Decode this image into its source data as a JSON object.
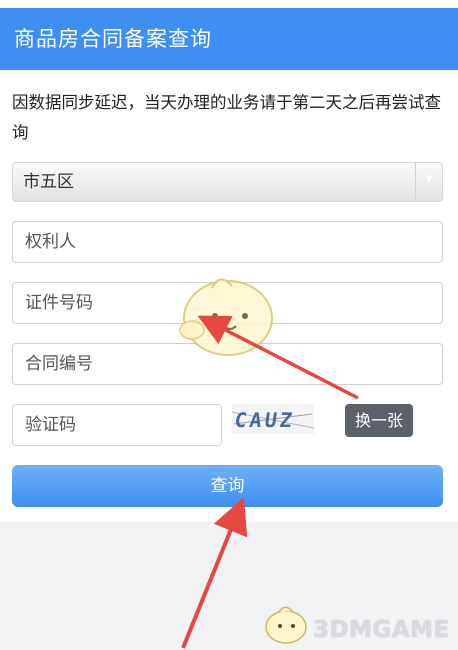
{
  "header": {
    "title": "商品房合同备案查询"
  },
  "notice": {
    "text": "因数据同步延迟，当天办理的业务请于第二天之后再尝试查询"
  },
  "district_select": {
    "value": "市五区"
  },
  "fields": {
    "owner": {
      "placeholder": "权利人"
    },
    "id_number": {
      "placeholder": "证件号码"
    },
    "contract_number": {
      "placeholder": "合同编号"
    },
    "captcha": {
      "placeholder": "验证码"
    }
  },
  "captcha_image": {
    "text": "CAUZ"
  },
  "buttons": {
    "swap_label": "换一张",
    "submit_label": "查询"
  },
  "watermark": {
    "text": "3DMGAME"
  },
  "colors": {
    "header": "#3f8ef2",
    "submit": "#3e8ef0",
    "arrow": "#e5483f",
    "swap_button": "#5b6168"
  }
}
